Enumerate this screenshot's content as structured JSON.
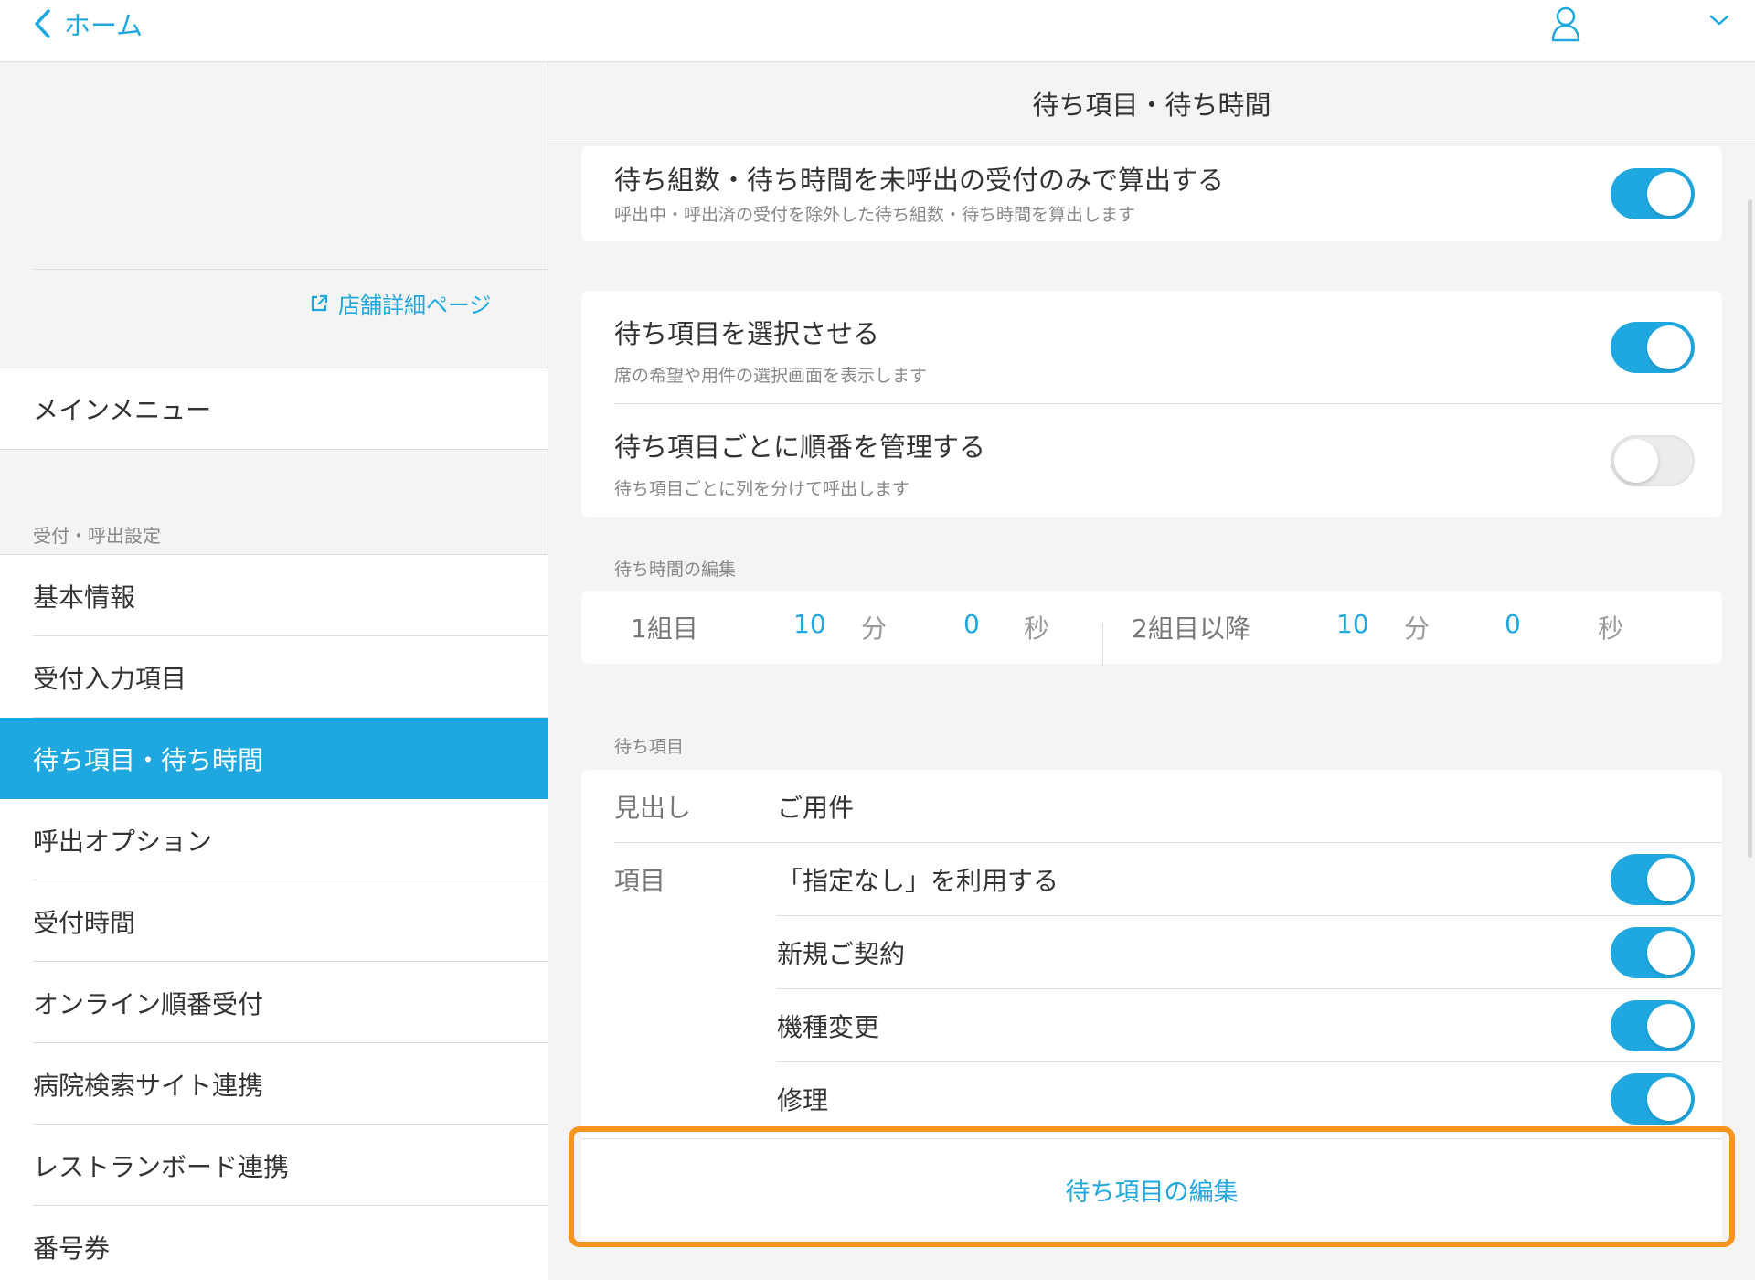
{
  "topbar": {
    "back_label": "ホーム",
    "user_icon": "user-icon",
    "dropdown_icon": "chevron-down-icon"
  },
  "sidebar": {
    "store_link": "店舗詳細ページ",
    "main_menu": "メインメニュー",
    "section_label": "受付・呼出設定",
    "items": [
      {
        "label": "基本情報",
        "active": false
      },
      {
        "label": "受付入力項目",
        "active": false
      },
      {
        "label": "待ち項目・待ち時間",
        "active": true
      },
      {
        "label": "呼出オプション",
        "active": false
      },
      {
        "label": "受付時間",
        "active": false
      },
      {
        "label": "オンライン順番受付",
        "active": false
      },
      {
        "label": "病院検索サイト連携",
        "active": false
      },
      {
        "label": "レストランボード連携",
        "active": false
      },
      {
        "label": "番号券",
        "active": false
      }
    ]
  },
  "main": {
    "title": "待ち項目・待ち時間",
    "settings": [
      {
        "title": "待ち組数・待ち時間を未呼出の受付のみで算出する",
        "desc": "呼出中・呼出済の受付を除外した待ち組数・待ち時間を算出します",
        "on": true
      },
      {
        "title": "待ち項目を選択させる",
        "desc": "席の希望や用件の選択画面を表示します",
        "on": true
      },
      {
        "title": "待ち項目ごとに順番を管理する",
        "desc": "待ち項目ごとに列を分けて呼出します",
        "on": false
      }
    ],
    "wait_time": {
      "label": "待ち時間の編集",
      "first_label": "1組目",
      "first_min": "10",
      "first_sec": "0",
      "second_label": "2組目以降",
      "second_min": "10",
      "second_sec": "0",
      "min_unit": "分",
      "sec_unit": "秒"
    },
    "wait_items": {
      "label": "待ち項目",
      "heading_label": "見出し",
      "heading_value": "ご用件",
      "items_label": "項目",
      "items": [
        {
          "label": "「指定なし」を利用する",
          "on": true
        },
        {
          "label": "新規ご契約",
          "on": true
        },
        {
          "label": "機種変更",
          "on": true
        },
        {
          "label": "修理",
          "on": true
        }
      ]
    },
    "edit_button": "待ち項目の編集"
  },
  "colors": {
    "accent": "#1fa8e0",
    "highlight": "#f7941d"
  }
}
